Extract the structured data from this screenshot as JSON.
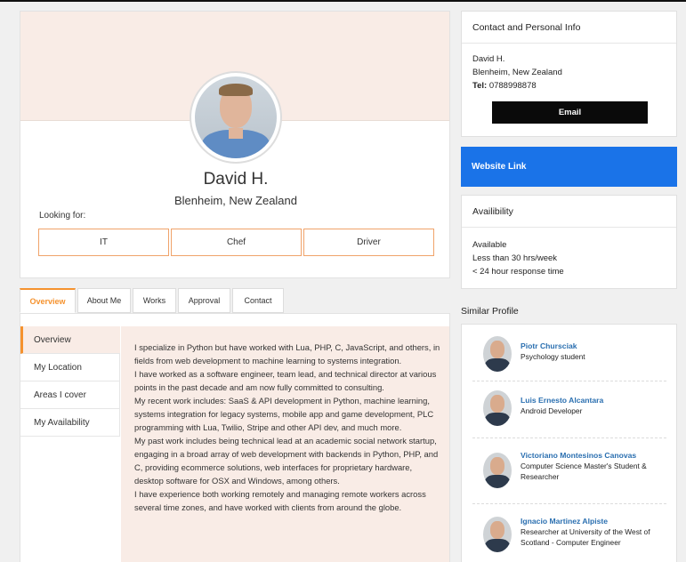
{
  "profile": {
    "name": "David H.",
    "location": "Blenheim, New Zealand",
    "looking_for_label": "Looking for:",
    "looking_for": [
      "IT",
      "Chef",
      "Driver"
    ]
  },
  "tabs": [
    "Overview",
    "About Me",
    "Works",
    "Approval",
    "Contact"
  ],
  "side_menu": [
    "Overview",
    "My Location",
    "Areas I cover",
    "My Availability"
  ],
  "overview": {
    "paragraphs": [
      "I specialize in Python but have worked with Lua, PHP, C, JavaScript, and others, in fields from web development to machine learning to systems integration.",
      "I have worked as a software engineer, team lead, and technical director at various points in the past decade and am now fully committed to consulting.",
      "My recent work includes: SaaS & API development in Python, machine learning, systems integration for legacy systems, mobile app and game development, PLC programming with Lua, Twilio, Stripe and other API dev, and much more.",
      "My past work includes being technical lead at an academic social network startup, engaging in a broad array of web development with backends in Python, PHP, and C, providing ecommerce solutions, web interfaces for proprietary hardware, desktop software for OSX and Windows, among others.",
      "I have experience both working remotely and managing remote workers across several time zones, and have worked with clients from around the globe."
    ]
  },
  "contact": {
    "title": "Contact and Personal Info",
    "name": "David H.",
    "location": "Blenheim, New Zealand",
    "tel_label": "Tel:",
    "tel": "0788998878",
    "email_button": "Email"
  },
  "website_link": "Website Link",
  "availability": {
    "title": "Availibility",
    "lines": [
      "Available",
      "Less than 30 hrs/week",
      "< 24 hour response time"
    ]
  },
  "similar": {
    "title": "Similar Profile",
    "items": [
      {
        "name": "Piotr Chursciak",
        "role": "Psychology student"
      },
      {
        "name": "Luis Ernesto Alcantara",
        "role": "Android Developer"
      },
      {
        "name": "Victoriano Montesinos Canovas",
        "role": "Computer Science Master's Student & Researcher"
      },
      {
        "name": "Ignacio Martinez Alpiste",
        "role": "Researcher at University of the West of Scotland - Computer Engineer"
      }
    ]
  },
  "colors": {
    "accent": "#f5922e",
    "cover": "#f9ece6",
    "link_blue": "#1a73e8",
    "name_blue": "#2a6fb0"
  }
}
